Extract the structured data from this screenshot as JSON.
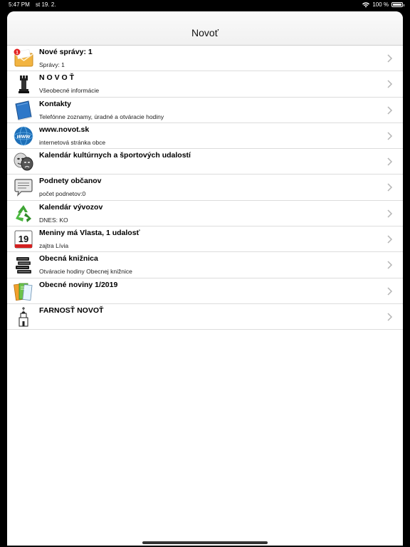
{
  "status": {
    "time": "5:47 PM",
    "date": "st 19. 2.",
    "battery": "100 %",
    "battery_level": 1.0
  },
  "nav": {
    "title": "Novoť"
  },
  "rows": [
    {
      "title": "Nové správy: 1",
      "subtitle": "Správy: 1",
      "icon": "mail-icon",
      "badge": "1"
    },
    {
      "title": "N O V O Ť",
      "subtitle": "Všeobecné informácie",
      "icon": "tower-icon"
    },
    {
      "title": "Kontakty",
      "subtitle": "Telefónne zoznamy, úradné a otváracie hodiny",
      "icon": "book-icon"
    },
    {
      "title": "www.novot.sk",
      "subtitle": "internetová stránka obce",
      "icon": "www-globe-icon"
    },
    {
      "title": "Kalendár kultúrnych a športových udalostí",
      "subtitle": "",
      "icon": "theater-masks-icon"
    },
    {
      "title": "Podnety občanov",
      "subtitle": "počet podnetov:0",
      "icon": "speech-bubble-icon"
    },
    {
      "title": "Kalendár vývozov",
      "subtitle": "DNES: KO",
      "icon": "recycle-icon"
    },
    {
      "title": "Meniny má Vlasta, 1 udalosť",
      "subtitle": "zajtra Lívia",
      "icon": "calendar-day-icon",
      "day": "19"
    },
    {
      "title": "Obecná knižnica",
      "subtitle": "Otváracie hodiny Obecnej knižnice",
      "icon": "books-stack-icon"
    },
    {
      "title": "Obecné noviny 1/2019",
      "subtitle": "",
      "icon": "newspapers-icon"
    },
    {
      "title": "FARNOSŤ NOVOŤ",
      "subtitle": "",
      "icon": "church-icon"
    }
  ]
}
